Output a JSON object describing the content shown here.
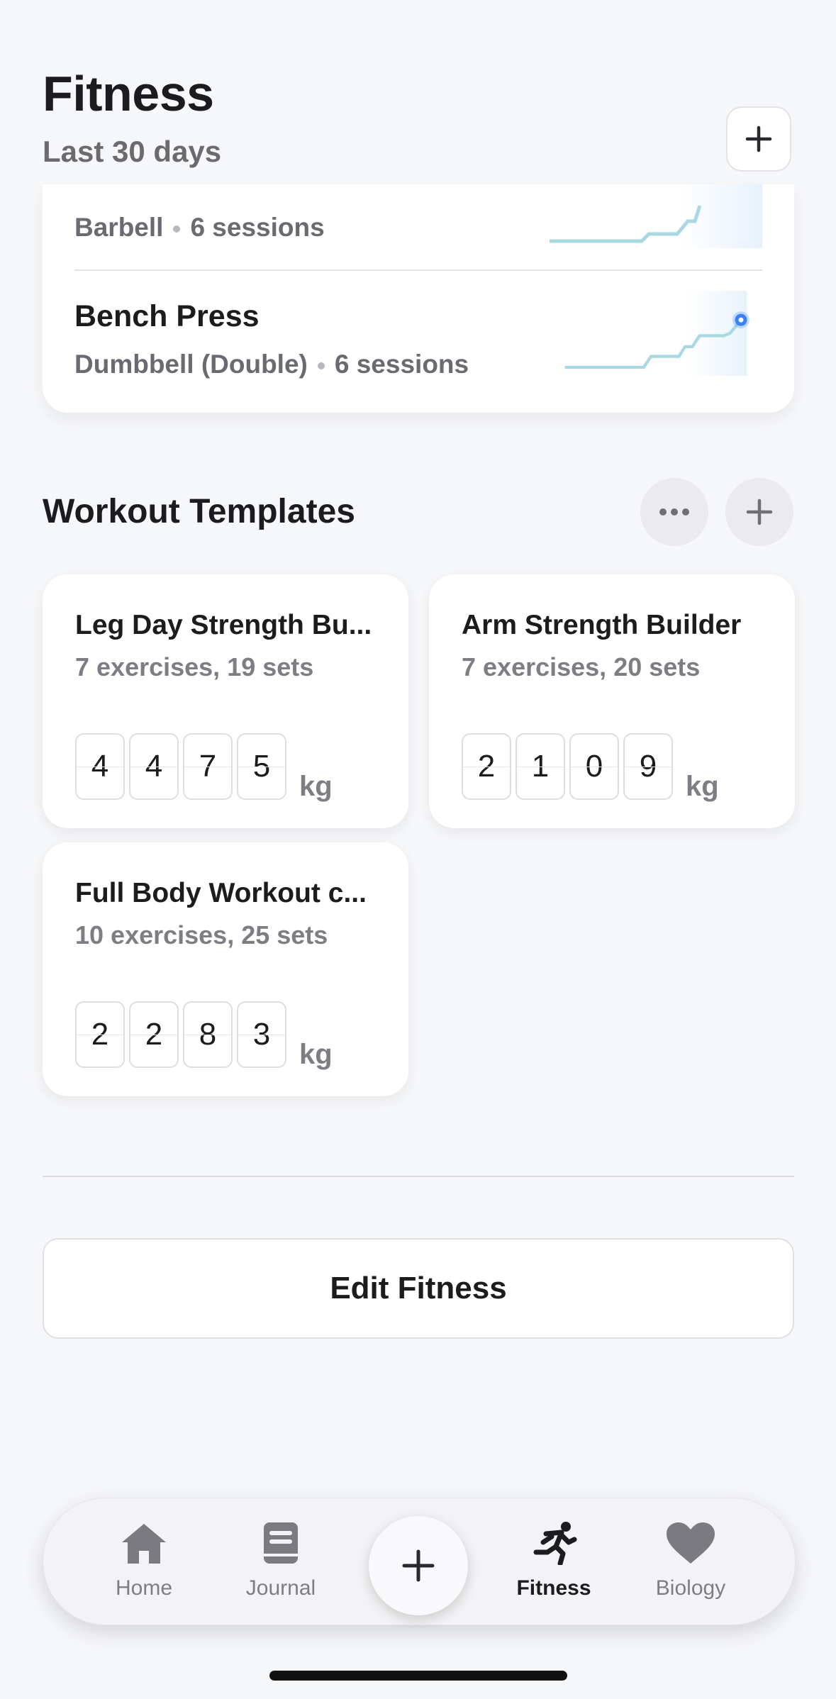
{
  "header": {
    "title": "Fitness",
    "subtitle": "Last 30 days"
  },
  "exercises": [
    {
      "name": "",
      "equipment": "Barbell",
      "sessions": "6 sessions"
    },
    {
      "name": "Bench Press",
      "equipment": "Dumbbell (Double)",
      "sessions": "6 sessions"
    }
  ],
  "templates_section": {
    "title": "Workout Templates"
  },
  "templates": [
    {
      "name": "Leg Day Strength Bu...",
      "meta": "7 exercises, 19 sets",
      "digits": [
        "4",
        "4",
        "7",
        "5"
      ],
      "unit": "kg"
    },
    {
      "name": "Arm Strength Builder",
      "meta": "7 exercises, 20 sets",
      "digits": [
        "2",
        "1",
        "0",
        "9"
      ],
      "unit": "kg"
    },
    {
      "name": "Full Body Workout c...",
      "meta": "10 exercises, 25 sets",
      "digits": [
        "2",
        "2",
        "8",
        "3"
      ],
      "unit": "kg"
    }
  ],
  "edit_button": "Edit Fitness",
  "tabs": [
    {
      "label": "Home",
      "icon": "home-icon"
    },
    {
      "label": "Journal",
      "icon": "book-icon"
    },
    {
      "label": "Fitness",
      "icon": "running-icon",
      "active": true
    },
    {
      "label": "Biology",
      "icon": "heart-icon"
    }
  ],
  "colors": {
    "accent": "#3b82f6",
    "sparkline": "#a9d8e2",
    "background": "#f6f7f9"
  }
}
